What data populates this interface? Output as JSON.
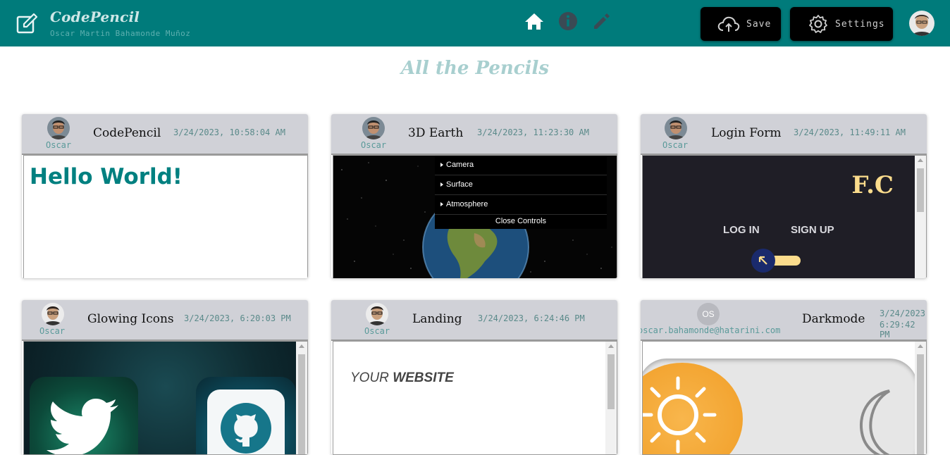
{
  "header": {
    "app_title": "CodePencil",
    "user_name": "Oscar Martin Bahamonde Muñoz",
    "nav": [
      "home-icon",
      "info-icon",
      "pencil-icon"
    ],
    "save_label": "Save",
    "settings_label": "Settings"
  },
  "page_title": "All the Pencils",
  "cards": [
    {
      "title": "CodePencil",
      "author": "Oscar",
      "date": "3/24/2023, 10:58:04 AM",
      "preview_text": "Hello World!"
    },
    {
      "title": "3D Earth",
      "author": "Oscar",
      "date": "3/24/2023, 11:23:30 AM",
      "controls": [
        "Camera",
        "Surface",
        "Atmosphere"
      ],
      "close_label": "Close Controls"
    },
    {
      "title": "Login Form",
      "author": "Oscar",
      "date": "3/24/2023, 11:49:11 AM",
      "brand": "F.C",
      "login": "LOG IN",
      "signup": "SIGN UP"
    },
    {
      "title": "Glowing Icons",
      "author": "Oscar",
      "date": "3/24/2023, 6:20:03 PM"
    },
    {
      "title": "Landing",
      "author": "Oscar",
      "date": "3/24/2023, 6:24:46 PM",
      "preview_text_1": "YOUR ",
      "preview_text_2": "WEBSITE"
    },
    {
      "title": "Darkmode",
      "author": "oscar.bahamonde@hatarini.com",
      "initials": "OS",
      "date_line1": "3/24/2023,",
      "date_line2": "6:29:42 PM"
    }
  ],
  "colors": {
    "header_bg": "#007b7b",
    "card_head_bg": "#d0d1d7",
    "accent_text": "#008080"
  }
}
